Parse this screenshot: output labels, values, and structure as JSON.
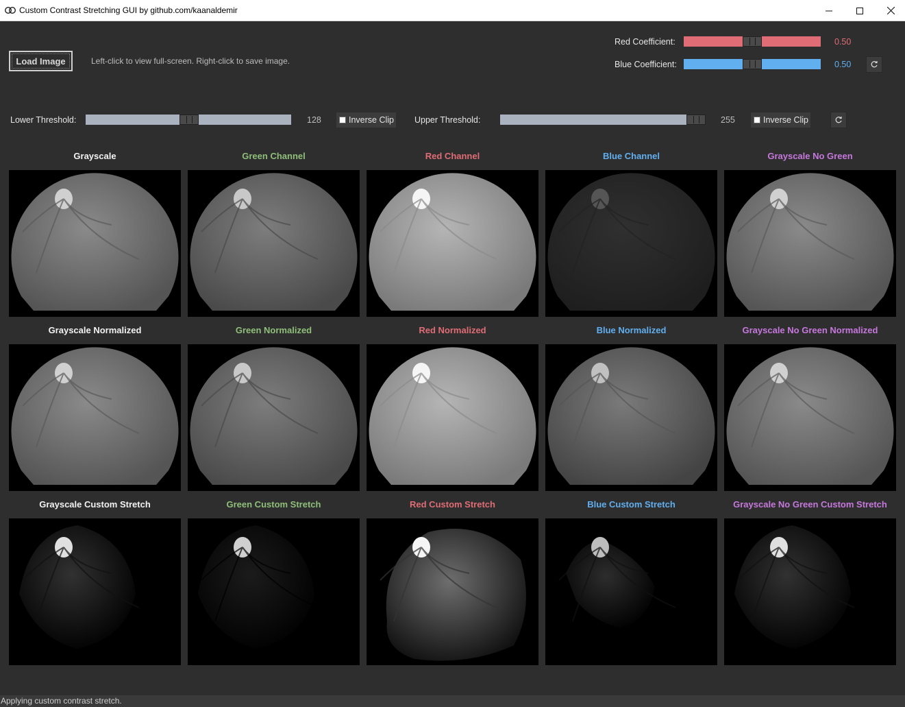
{
  "window": {
    "title": "Custom Contrast Stretching GUI by github.com/kaanaldemir"
  },
  "controls": {
    "load_label": "Load Image",
    "hint": "Left-click to view full-screen. Right-click to save image.",
    "red_label": "Red Coefficient:",
    "red_value": "0.50",
    "red_fraction": 0.5,
    "blue_label": "Blue Coefficient:",
    "blue_value": "0.50",
    "blue_fraction": 0.5,
    "lower_label": "Lower Threshold:",
    "lower_value": "128",
    "lower_fraction": 0.502,
    "upper_label": "Upper Threshold:",
    "upper_value": "255",
    "upper_fraction": 1.0,
    "inverse_clip_label": "Inverse Clip"
  },
  "colors": {
    "white": "#f2f2f2",
    "green": "#8fbf7a",
    "red": "#e06c75",
    "blue": "#61afef",
    "purple": "#c678dd",
    "red_track": "#e06c75",
    "blue_track": "#61afef",
    "gray_track": "#aab2bf"
  },
  "grid": {
    "row1": [
      "Grayscale",
      "Green Channel",
      "Red Channel",
      "Blue Channel",
      "Grayscale No Green"
    ],
    "row2": [
      "Grayscale Normalized",
      "Green Normalized",
      "Red Normalized",
      "Blue Normalized",
      "Grayscale No Green Normalized"
    ],
    "row3": [
      "Grayscale Custom Stretch",
      "Green Custom Stretch",
      "Red Custom Stretch",
      "Blue Custom Stretch",
      "Grayscale No Green Custom Stretch"
    ]
  },
  "status": {
    "text": "Applying custom contrast stretch."
  }
}
